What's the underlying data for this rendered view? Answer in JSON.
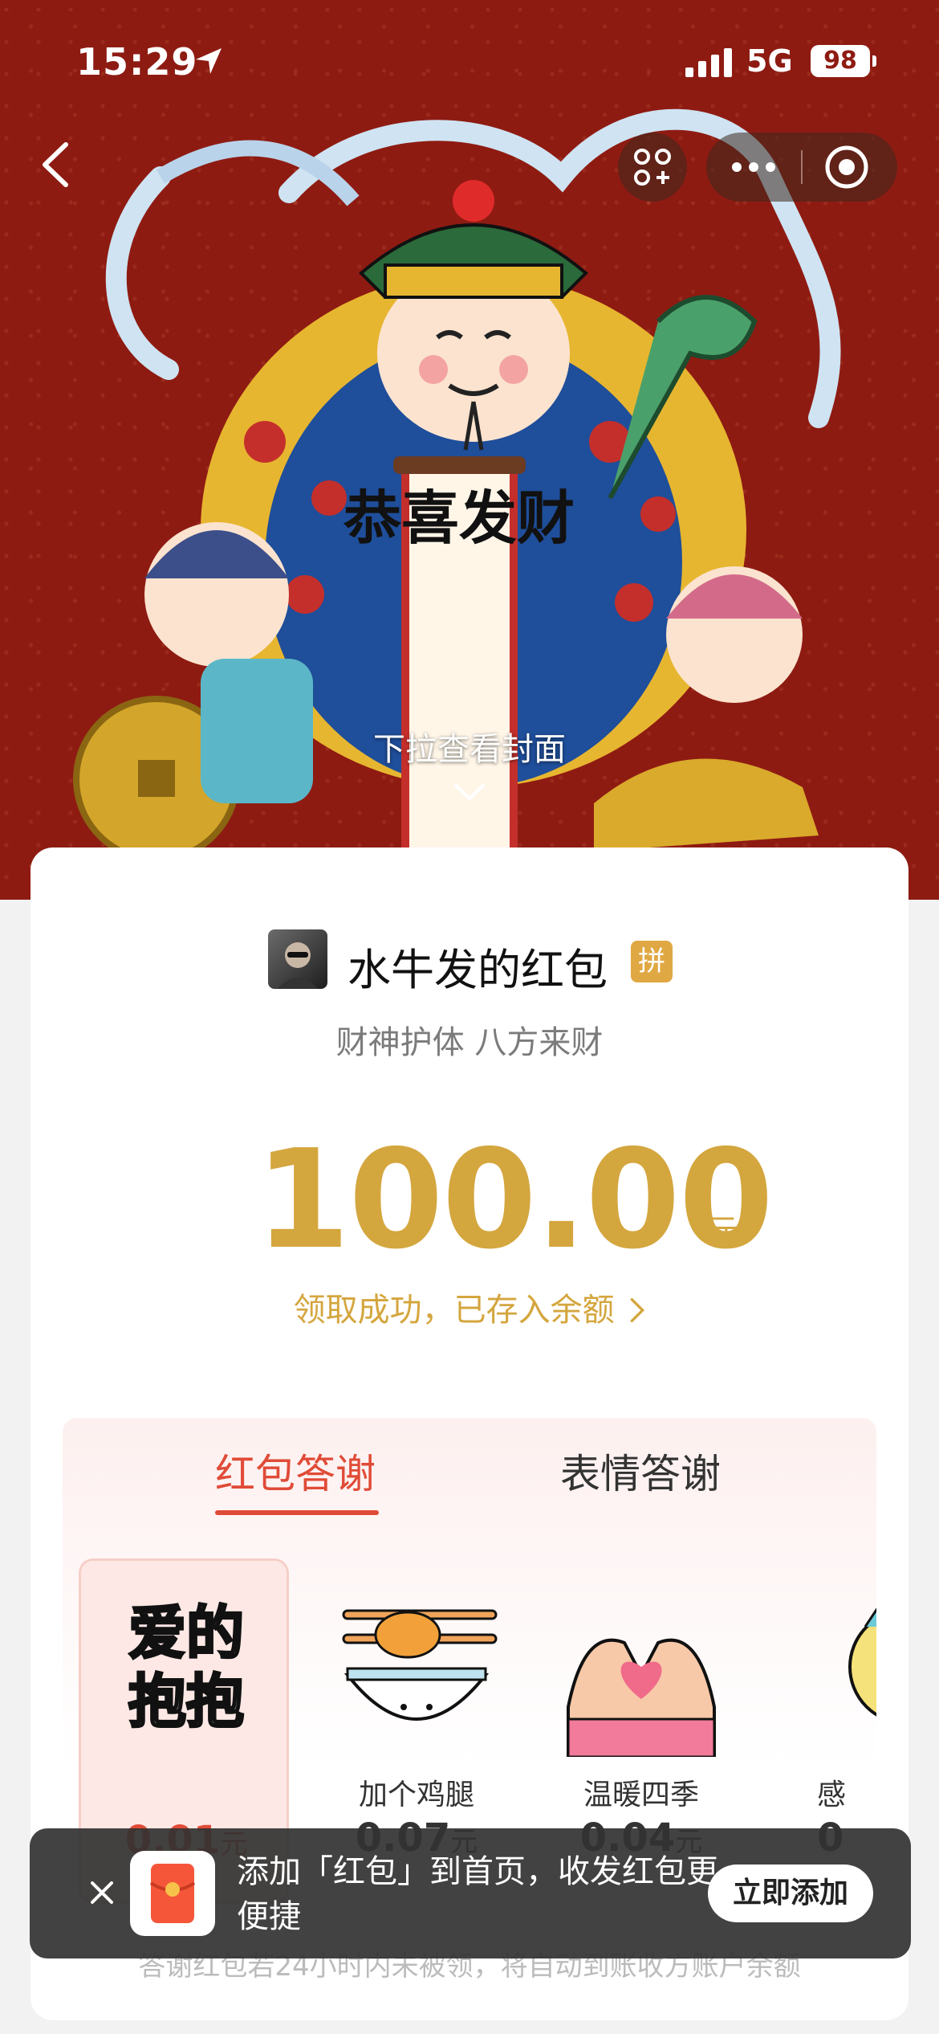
{
  "status_bar": {
    "time": "15:29",
    "network": "5G",
    "battery": "98"
  },
  "cover": {
    "scroll_text": "恭喜发财",
    "pull_hint": "下拉查看封面"
  },
  "packet": {
    "sender_name": "水牛发的红包",
    "group_badge": "拼",
    "greeting": "财神护体 八方来财",
    "amount": "100.00",
    "amount_unit": "元",
    "received_text": "领取成功，已存入余额"
  },
  "thanks": {
    "tabs": [
      {
        "label": "红包答谢"
      },
      {
        "label": "表情答谢"
      }
    ],
    "gifts": [
      {
        "art_text_1": "爱的",
        "art_text_2": "抱抱",
        "name": "",
        "price": "0.01",
        "unit": "元"
      },
      {
        "name": "加个鸡腿",
        "price": "0.07",
        "unit": "元"
      },
      {
        "name": "温暖四季",
        "price": "0.04",
        "unit": "元"
      },
      {
        "name": "感",
        "price": "0",
        "unit": ""
      }
    ],
    "auto_note": "答谢红包若24小时内未被领，将自动到账收方账户余额"
  },
  "toast": {
    "text": "添加「红包」到首页，收发红包更便捷",
    "button": "立即添加"
  },
  "colors": {
    "cover_red": "#8e1b12",
    "gold": "#d4a63e",
    "accent_red": "#e04b37"
  }
}
